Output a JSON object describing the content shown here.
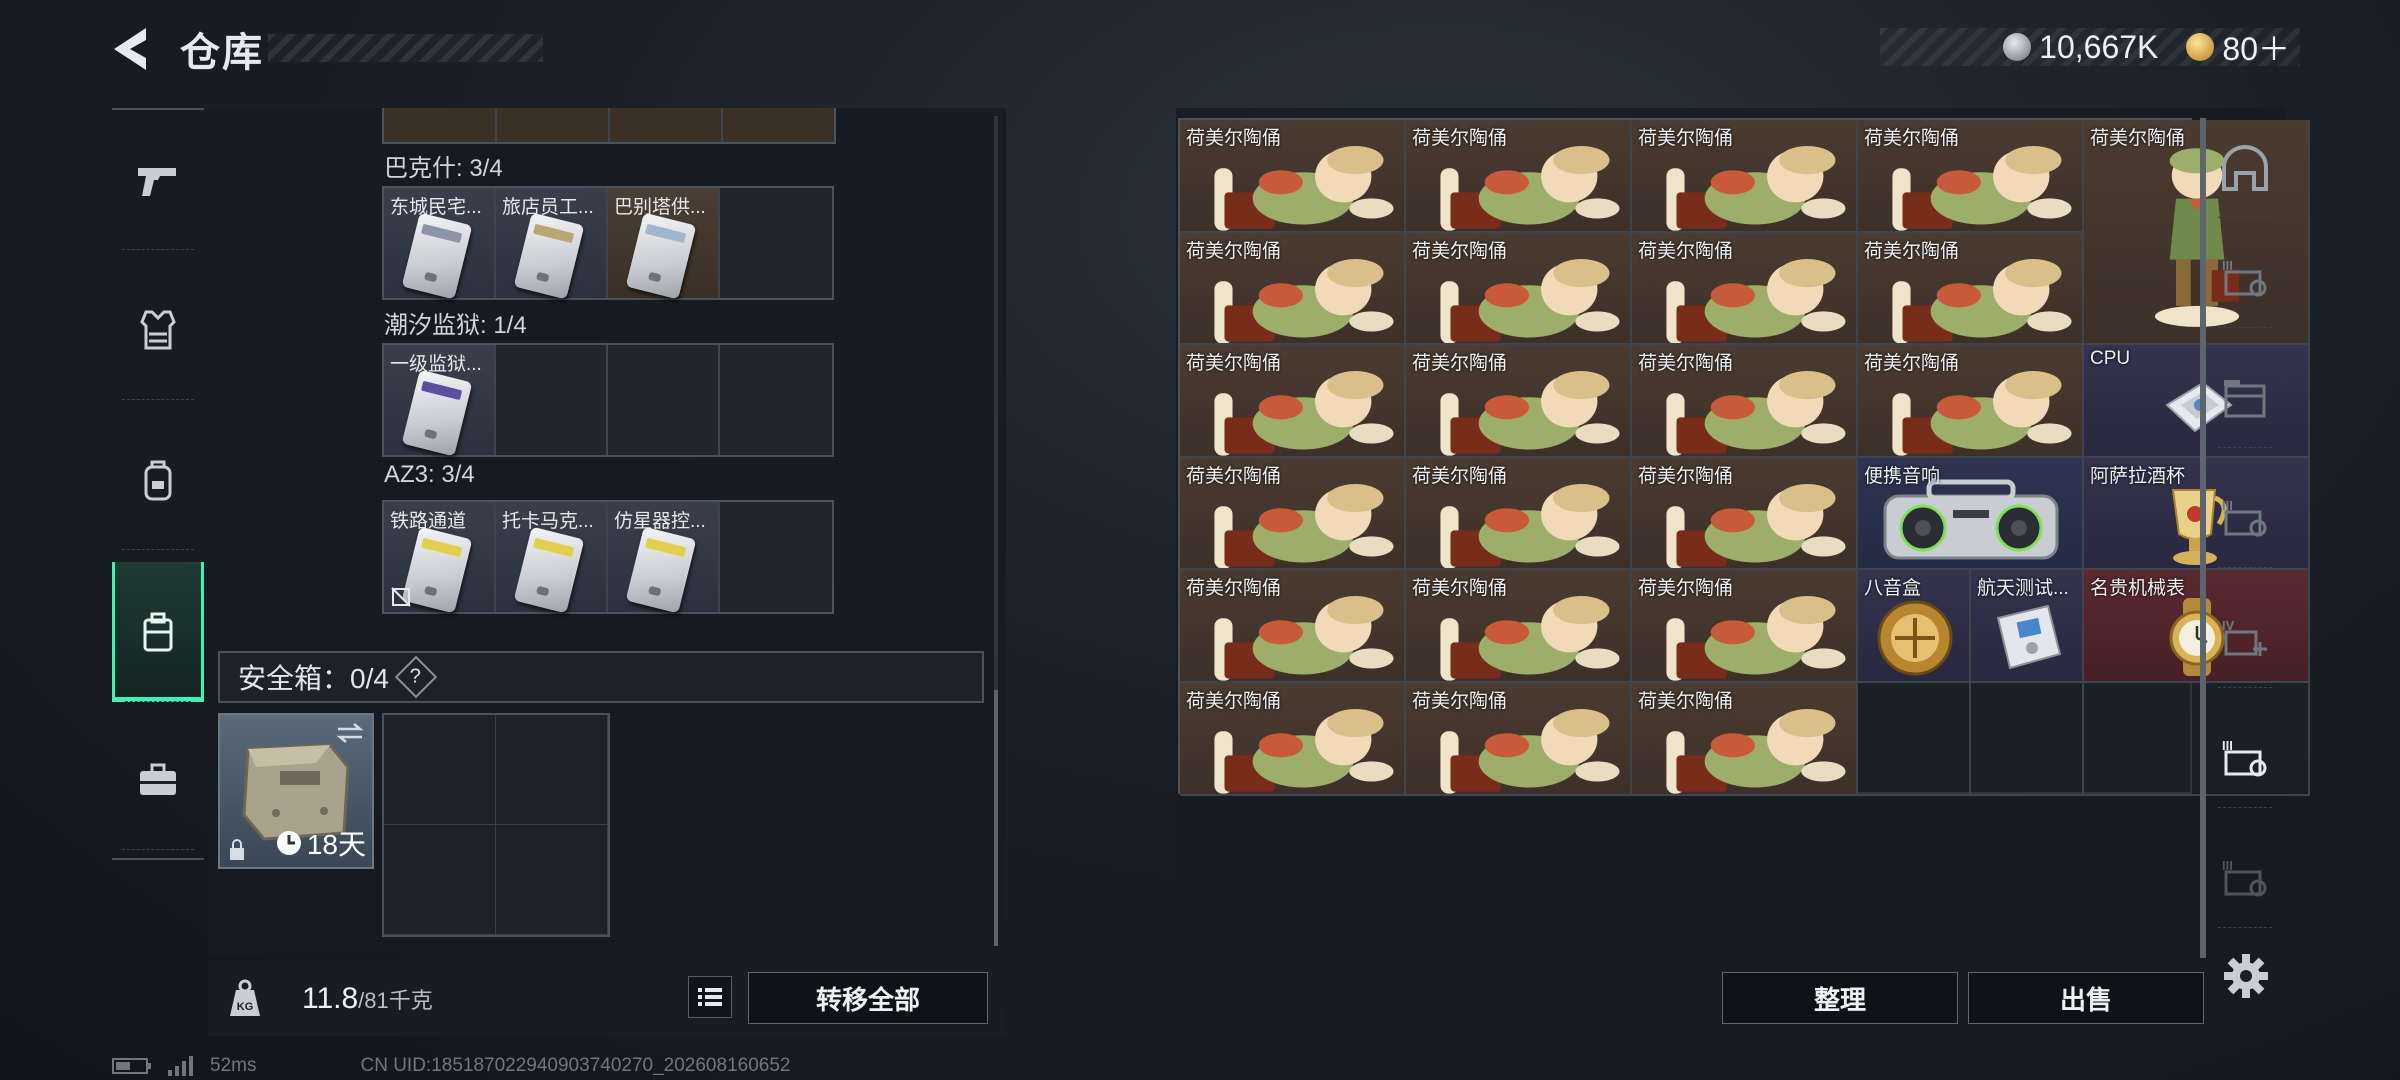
{
  "header": {
    "title": "仓库",
    "currency": [
      {
        "icon": "silver-coin-icon",
        "value": "10,667K"
      },
      {
        "icon": "gold-coin-icon",
        "value": "80＋"
      }
    ]
  },
  "left_rail": [
    "pistol-icon",
    "armor-vest-icon",
    "backpack-icon",
    "case-icon",
    "briefcase-icon"
  ],
  "key_sections": [
    {
      "label": "巴克什: 3/4",
      "slots": [
        {
          "name": "东城民宅...",
          "color": "blue",
          "card": "#c7c9d6"
        },
        {
          "name": "旅店员工...",
          "color": "blue",
          "card": "#d9d2c0"
        },
        {
          "name": "巴别塔供...",
          "color": "orange",
          "card": "#cfd8e2"
        },
        {
          "name": "",
          "color": "empty"
        }
      ]
    },
    {
      "label": "潮汐监狱: 1/4",
      "slots": [
        {
          "name": "一级监狱...",
          "color": "blue",
          "card": "#d6c36a"
        },
        {
          "name": "",
          "color": "empty"
        },
        {
          "name": "",
          "color": "empty"
        },
        {
          "name": "",
          "color": "empty"
        }
      ]
    },
    {
      "label": "AZ3: 3/4",
      "slots": [
        {
          "name": "铁路通道",
          "color": "blue",
          "card": "#e6d56a",
          "nodrop": true
        },
        {
          "name": "托卡马克...",
          "color": "blue",
          "card": "#e6d56a"
        },
        {
          "name": "仿星器控...",
          "color": "blue",
          "card": "#e6d56a"
        },
        {
          "name": "",
          "color": "empty"
        }
      ]
    }
  ],
  "safe_box": {
    "label": "安全箱：0/4",
    "help": "?",
    "days": "18天"
  },
  "weight": {
    "current": "11.8",
    "max": "/81千克"
  },
  "buttons": {
    "transfer_all": "转移全部",
    "tidy": "整理",
    "sell": "出售"
  },
  "stash_items": [
    {
      "name": "荷美尔陶俑",
      "col": 0,
      "row": 0,
      "w": 1,
      "h": 1,
      "color": "brown",
      "icon": "figurine"
    },
    {
      "name": "荷美尔陶俑",
      "col": 1,
      "row": 0,
      "w": 1,
      "h": 1,
      "color": "brown",
      "icon": "figurine"
    },
    {
      "name": "荷美尔陶俑",
      "col": 2,
      "row": 0,
      "w": 1,
      "h": 1,
      "color": "brown",
      "icon": "figurine"
    },
    {
      "name": "荷美尔陶俑",
      "col": 3,
      "row": 0,
      "w": 1,
      "h": 1,
      "color": "brown",
      "icon": "figurine"
    },
    {
      "name": "荷美尔陶俑",
      "col": 4,
      "row": 0,
      "w": 1,
      "h": 2,
      "color": "brown",
      "icon": "figurine-standing"
    },
    {
      "name": "荷美尔陶俑",
      "col": 0,
      "row": 1,
      "w": 1,
      "h": 1,
      "color": "brown",
      "icon": "figurine"
    },
    {
      "name": "荷美尔陶俑",
      "col": 1,
      "row": 1,
      "w": 1,
      "h": 1,
      "color": "brown",
      "icon": "figurine"
    },
    {
      "name": "荷美尔陶俑",
      "col": 2,
      "row": 1,
      "w": 1,
      "h": 1,
      "color": "brown",
      "icon": "figurine"
    },
    {
      "name": "荷美尔陶俑",
      "col": 3,
      "row": 1,
      "w": 1,
      "h": 1,
      "color": "brown",
      "icon": "figurine"
    },
    {
      "name": "荷美尔陶俑",
      "col": 0,
      "row": 2,
      "w": 1,
      "h": 1,
      "color": "brown",
      "icon": "figurine"
    },
    {
      "name": "荷美尔陶俑",
      "col": 1,
      "row": 2,
      "w": 1,
      "h": 1,
      "color": "brown",
      "icon": "figurine"
    },
    {
      "name": "荷美尔陶俑",
      "col": 2,
      "row": 2,
      "w": 1,
      "h": 1,
      "color": "brown",
      "icon": "figurine"
    },
    {
      "name": "荷美尔陶俑",
      "col": 3,
      "row": 2,
      "w": 1,
      "h": 1,
      "color": "brown",
      "icon": "figurine"
    },
    {
      "name": "CPU",
      "col": 4,
      "row": 2,
      "w": 1,
      "h": 1,
      "color": "purple",
      "icon": "cpu"
    },
    {
      "name": "荷美尔陶俑",
      "col": 0,
      "row": 3,
      "w": 1,
      "h": 1,
      "color": "brown",
      "icon": "figurine"
    },
    {
      "name": "荷美尔陶俑",
      "col": 1,
      "row": 3,
      "w": 1,
      "h": 1,
      "color": "brown",
      "icon": "figurine"
    },
    {
      "name": "荷美尔陶俑",
      "col": 2,
      "row": 3,
      "w": 1,
      "h": 1,
      "color": "brown",
      "icon": "figurine"
    },
    {
      "name": "便携音响",
      "col": 3,
      "row": 3,
      "w": 1,
      "h": 1,
      "color": "blue",
      "icon": "boombox"
    },
    {
      "name": "阿萨拉酒杯",
      "col": 4,
      "row": 3,
      "w": 1,
      "h": 1,
      "color": "purple",
      "icon": "goblet"
    },
    {
      "name": "荷美尔陶俑",
      "col": 0,
      "row": 4,
      "w": 1,
      "h": 1,
      "color": "brown",
      "icon": "figurine"
    },
    {
      "name": "荷美尔陶俑",
      "col": 1,
      "row": 4,
      "w": 1,
      "h": 1,
      "color": "brown",
      "icon": "figurine"
    },
    {
      "name": "荷美尔陶俑",
      "col": 2,
      "row": 4,
      "w": 1,
      "h": 1,
      "color": "brown",
      "icon": "figurine"
    },
    {
      "name": "八音盒",
      "col": 3,
      "row": 4,
      "w": 0.5,
      "h": 1,
      "color": "purple",
      "icon": "music-box"
    },
    {
      "name": "航天测试...",
      "col": 3.5,
      "row": 4,
      "w": 0.5,
      "h": 1,
      "color": "purple",
      "icon": "test-device"
    },
    {
      "name": "名贵机械表",
      "col": 4,
      "row": 4,
      "w": 1,
      "h": 1,
      "color": "red",
      "icon": "watch"
    },
    {
      "name": "荷美尔陶俑",
      "col": 0,
      "row": 5,
      "w": 1,
      "h": 1,
      "color": "brown",
      "icon": "figurine"
    },
    {
      "name": "荷美尔陶俑",
      "col": 1,
      "row": 5,
      "w": 1,
      "h": 1,
      "color": "brown",
      "icon": "figurine"
    },
    {
      "name": "荷美尔陶俑",
      "col": 2,
      "row": 5,
      "w": 1,
      "h": 1,
      "color": "brown",
      "icon": "figurine"
    },
    {
      "name": "",
      "col": 3,
      "row": 5,
      "w": 0.5,
      "h": 1,
      "color": "empty",
      "icon": ""
    },
    {
      "name": "",
      "col": 3.5,
      "row": 5,
      "w": 0.5,
      "h": 1,
      "color": "empty",
      "icon": ""
    },
    {
      "name": "",
      "col": 4,
      "row": 5,
      "w": 1,
      "h": 1,
      "color": "empty",
      "icon": ""
    }
  ],
  "right_rail": [
    "shelter-icon",
    "tier-3-container-icon",
    "storage-icon",
    "tier-3-container-icon",
    "tier-4-container-icon",
    "tier-3-container-active-icon",
    "tier-3-container-icon"
  ],
  "footer": {
    "ping": "52ms",
    "uid": "CN UID:185187022940903740270_202608160652"
  }
}
